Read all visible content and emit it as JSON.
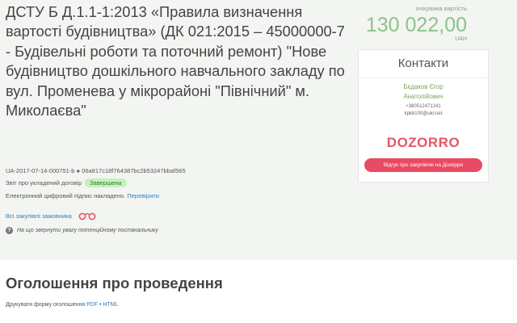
{
  "tender": {
    "title": "ДСТУ Б Д.1.1-1:2013 «Правила визначення вартості будівництва» (ДК 021:2015 – 45000000-7 - Будівельні роботи та поточний ремонт) \"Нове будівництво дошкільного навчального закладу по вул. Променева у мікрорайоні \"Північний\" м. Миколаєва\"",
    "id_line": "UA-2017-07-14-000751-b ● 06a817c18f764387bc2b53247bbaf565",
    "report_label": "Звіт про укладений договір",
    "status_badge": "Завершена",
    "signature_text": "Електронний цифровий підпис накладено.",
    "verify_link": "Перевірити",
    "all_purchases_link": "Всі закупівлі замовника",
    "attention_text": "На що звернути увагу потенційному постачальнику"
  },
  "price": {
    "label": "очікувана вартість",
    "amount": "130 022,00",
    "currency": "UAH"
  },
  "contacts": {
    "title": "Контакти",
    "name_line1": "Бєдаков Єгор",
    "name_line2": "Анатолійович",
    "phone": "+380512471241",
    "email": "kpkb100@ukr.net",
    "brand": "DOZORRO",
    "review_button": "Відгук про закупівлю на Дозорро"
  },
  "announcement": {
    "title": "Оголошення про проведення",
    "print_label": "Друкувати форму оголошення",
    "pdf_link": "PDF",
    "separator": "•",
    "html_link": "HTML"
  },
  "colors": {
    "accent_green": "#8ec18a",
    "link_blue": "#2f7fc1",
    "dozorro_red": "#e65663"
  },
  "icons": {
    "handcuffs": "handcuffs-icon",
    "help": "question-circle-icon"
  }
}
